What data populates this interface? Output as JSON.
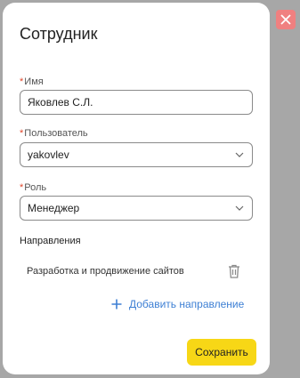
{
  "modal": {
    "title": "Сотрудник",
    "close_icon": "close-icon"
  },
  "fields": {
    "name": {
      "required_mark": "*",
      "label": "Имя",
      "value": "Яковлев С.Л."
    },
    "user": {
      "required_mark": "*",
      "label": "Пользователь",
      "value": "yakovlev"
    },
    "role": {
      "required_mark": "*",
      "label": "Роль",
      "value": "Менеджер"
    }
  },
  "directions": {
    "title": "Направления",
    "items": [
      {
        "label": "Разработка и продвижение сайтов",
        "icon": "trash-icon"
      }
    ],
    "add_label": "Добавить направление"
  },
  "actions": {
    "save_label": "Сохранить"
  },
  "colors": {
    "overlay": "#a7a7a7",
    "close_bg": "#f08080",
    "required": "#e0452a",
    "link": "#3d7fd4",
    "save_bg": "#f7d716"
  }
}
